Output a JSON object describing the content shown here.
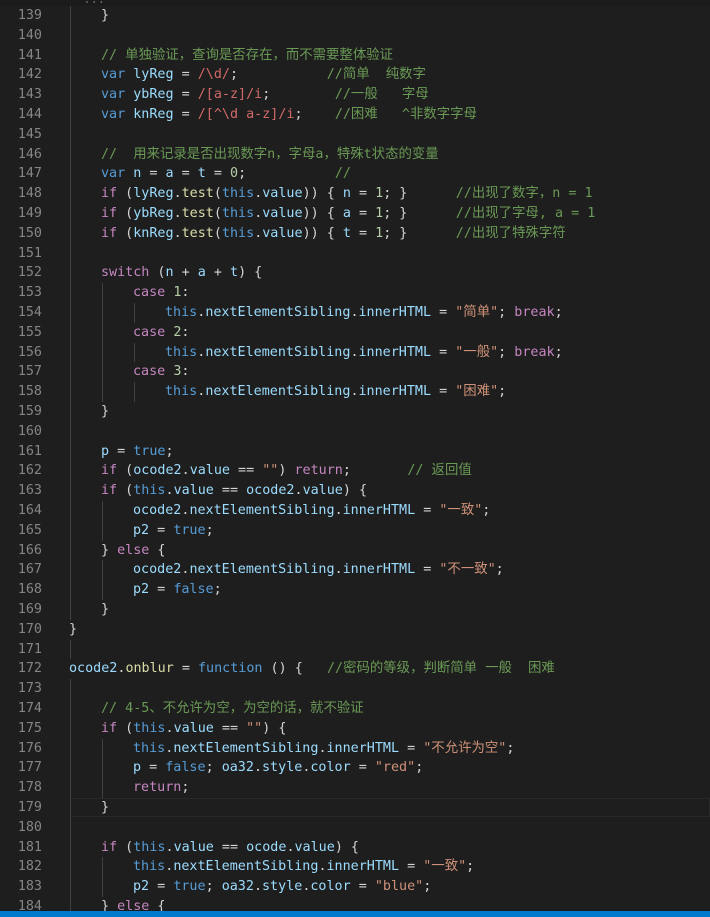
{
  "top_strip_text": "      ...",
  "lines": [
    {
      "n": "139",
      "indent": 2,
      "tokens": [
        [
          "pn",
          "}"
        ]
      ]
    },
    {
      "n": "140",
      "indent": 0,
      "tokens": []
    },
    {
      "n": "141",
      "indent": 2,
      "tokens": [
        [
          "cmt",
          "// 单独验证，查询是否存在，而不需要整体验证"
        ]
      ]
    },
    {
      "n": "142",
      "indent": 2,
      "tokens": [
        [
          "kw",
          "var"
        ],
        [
          "pn",
          " "
        ],
        [
          "var",
          "lyReg"
        ],
        [
          "pn",
          " = "
        ],
        [
          "re",
          "/\\d/"
        ],
        [
          "pn",
          ";           "
        ],
        [
          "cmt",
          "//简单  纯数字"
        ]
      ]
    },
    {
      "n": "143",
      "indent": 2,
      "tokens": [
        [
          "kw",
          "var"
        ],
        [
          "pn",
          " "
        ],
        [
          "var",
          "ybReg"
        ],
        [
          "pn",
          " = "
        ],
        [
          "re",
          "/[a-z]/i"
        ],
        [
          "pn",
          ";        "
        ],
        [
          "cmt",
          "//一般   字母"
        ]
      ]
    },
    {
      "n": "144",
      "indent": 2,
      "tokens": [
        [
          "kw",
          "var"
        ],
        [
          "pn",
          " "
        ],
        [
          "var",
          "knReg"
        ],
        [
          "pn",
          " = "
        ],
        [
          "re",
          "/[^\\d a-z]/i"
        ],
        [
          "pn",
          ";    "
        ],
        [
          "cmt",
          "//困难   ^非数字字母"
        ]
      ]
    },
    {
      "n": "145",
      "indent": 0,
      "tokens": []
    },
    {
      "n": "146",
      "indent": 2,
      "tokens": [
        [
          "cmt",
          "//  用来记录是否出现数字n，字母a，特殊t状态的变量"
        ]
      ]
    },
    {
      "n": "147",
      "indent": 2,
      "tokens": [
        [
          "kw",
          "var"
        ],
        [
          "pn",
          " "
        ],
        [
          "var",
          "n"
        ],
        [
          "pn",
          " = "
        ],
        [
          "var",
          "a"
        ],
        [
          "pn",
          " = "
        ],
        [
          "var",
          "t"
        ],
        [
          "pn",
          " = "
        ],
        [
          "num",
          "0"
        ],
        [
          "pn",
          ";           "
        ],
        [
          "cmt",
          "//"
        ]
      ]
    },
    {
      "n": "148",
      "indent": 2,
      "tokens": [
        [
          "ctl",
          "if"
        ],
        [
          "pn",
          " ("
        ],
        [
          "var",
          "lyReg"
        ],
        [
          "pn",
          "."
        ],
        [
          "fn",
          "test"
        ],
        [
          "pn",
          "("
        ],
        [
          "kw",
          "this"
        ],
        [
          "pn",
          "."
        ],
        [
          "var",
          "value"
        ],
        [
          "pn",
          ")) { "
        ],
        [
          "var",
          "n"
        ],
        [
          "pn",
          " = "
        ],
        [
          "num",
          "1"
        ],
        [
          "pn",
          "; }      "
        ],
        [
          "cmt",
          "//出现了数字，n = 1"
        ]
      ]
    },
    {
      "n": "149",
      "indent": 2,
      "tokens": [
        [
          "ctl",
          "if"
        ],
        [
          "pn",
          " ("
        ],
        [
          "var",
          "ybReg"
        ],
        [
          "pn",
          "."
        ],
        [
          "fn",
          "test"
        ],
        [
          "pn",
          "("
        ],
        [
          "kw",
          "this"
        ],
        [
          "pn",
          "."
        ],
        [
          "var",
          "value"
        ],
        [
          "pn",
          ")) { "
        ],
        [
          "var",
          "a"
        ],
        [
          "pn",
          " = "
        ],
        [
          "num",
          "1"
        ],
        [
          "pn",
          "; }      "
        ],
        [
          "cmt",
          "//出现了字母, a = 1"
        ]
      ]
    },
    {
      "n": "150",
      "indent": 2,
      "tokens": [
        [
          "ctl",
          "if"
        ],
        [
          "pn",
          " ("
        ],
        [
          "var",
          "knReg"
        ],
        [
          "pn",
          "."
        ],
        [
          "fn",
          "test"
        ],
        [
          "pn",
          "("
        ],
        [
          "kw",
          "this"
        ],
        [
          "pn",
          "."
        ],
        [
          "var",
          "value"
        ],
        [
          "pn",
          ")) { "
        ],
        [
          "var",
          "t"
        ],
        [
          "pn",
          " = "
        ],
        [
          "num",
          "1"
        ],
        [
          "pn",
          "; }      "
        ],
        [
          "cmt",
          "//出现了特殊字符"
        ]
      ]
    },
    {
      "n": "151",
      "indent": 0,
      "tokens": []
    },
    {
      "n": "152",
      "indent": 2,
      "tokens": [
        [
          "ctl",
          "switch"
        ],
        [
          "pn",
          " ("
        ],
        [
          "var",
          "n"
        ],
        [
          "pn",
          " + "
        ],
        [
          "var",
          "a"
        ],
        [
          "pn",
          " + "
        ],
        [
          "var",
          "t"
        ],
        [
          "pn",
          ") {"
        ]
      ]
    },
    {
      "n": "153",
      "indent": 3,
      "tokens": [
        [
          "ctl",
          "case"
        ],
        [
          "pn",
          " "
        ],
        [
          "num",
          "1"
        ],
        [
          "pn",
          ":"
        ]
      ]
    },
    {
      "n": "154",
      "indent": 4,
      "tokens": [
        [
          "kw",
          "this"
        ],
        [
          "pn",
          "."
        ],
        [
          "var",
          "nextElementSibling"
        ],
        [
          "pn",
          "."
        ],
        [
          "var",
          "innerHTML"
        ],
        [
          "pn",
          " = "
        ],
        [
          "str",
          "\"简单\""
        ],
        [
          "pn",
          "; "
        ],
        [
          "ctl",
          "break"
        ],
        [
          "pn",
          ";"
        ]
      ]
    },
    {
      "n": "155",
      "indent": 3,
      "tokens": [
        [
          "ctl",
          "case"
        ],
        [
          "pn",
          " "
        ],
        [
          "num",
          "2"
        ],
        [
          "pn",
          ":"
        ]
      ]
    },
    {
      "n": "156",
      "indent": 4,
      "tokens": [
        [
          "kw",
          "this"
        ],
        [
          "pn",
          "."
        ],
        [
          "var",
          "nextElementSibling"
        ],
        [
          "pn",
          "."
        ],
        [
          "var",
          "innerHTML"
        ],
        [
          "pn",
          " = "
        ],
        [
          "str",
          "\"一般\""
        ],
        [
          "pn",
          "; "
        ],
        [
          "ctl",
          "break"
        ],
        [
          "pn",
          ";"
        ]
      ]
    },
    {
      "n": "157",
      "indent": 3,
      "tokens": [
        [
          "ctl",
          "case"
        ],
        [
          "pn",
          " "
        ],
        [
          "num",
          "3"
        ],
        [
          "pn",
          ":"
        ]
      ]
    },
    {
      "n": "158",
      "indent": 4,
      "tokens": [
        [
          "kw",
          "this"
        ],
        [
          "pn",
          "."
        ],
        [
          "var",
          "nextElementSibling"
        ],
        [
          "pn",
          "."
        ],
        [
          "var",
          "innerHTML"
        ],
        [
          "pn",
          " = "
        ],
        [
          "str",
          "\"困难\""
        ],
        [
          "pn",
          ";"
        ]
      ]
    },
    {
      "n": "159",
      "indent": 2,
      "tokens": [
        [
          "pn",
          "}"
        ]
      ]
    },
    {
      "n": "160",
      "indent": 0,
      "tokens": []
    },
    {
      "n": "161",
      "indent": 2,
      "tokens": [
        [
          "var",
          "p"
        ],
        [
          "pn",
          " = "
        ],
        [
          "kw",
          "true"
        ],
        [
          "pn",
          ";"
        ]
      ]
    },
    {
      "n": "162",
      "indent": 2,
      "tokens": [
        [
          "ctl",
          "if"
        ],
        [
          "pn",
          " ("
        ],
        [
          "var",
          "ocode2"
        ],
        [
          "pn",
          "."
        ],
        [
          "var",
          "value"
        ],
        [
          "pn",
          " == "
        ],
        [
          "str",
          "\"\""
        ],
        [
          "pn",
          ") "
        ],
        [
          "ctl",
          "return"
        ],
        [
          "pn",
          ";       "
        ],
        [
          "cmt",
          "// 返回值"
        ]
      ]
    },
    {
      "n": "163",
      "indent": 2,
      "tokens": [
        [
          "ctl",
          "if"
        ],
        [
          "pn",
          " ("
        ],
        [
          "kw",
          "this"
        ],
        [
          "pn",
          "."
        ],
        [
          "var",
          "value"
        ],
        [
          "pn",
          " == "
        ],
        [
          "var",
          "ocode2"
        ],
        [
          "pn",
          "."
        ],
        [
          "var",
          "value"
        ],
        [
          "pn",
          ") {"
        ]
      ]
    },
    {
      "n": "164",
      "indent": 3,
      "tokens": [
        [
          "var",
          "ocode2"
        ],
        [
          "pn",
          "."
        ],
        [
          "var",
          "nextElementSibling"
        ],
        [
          "pn",
          "."
        ],
        [
          "var",
          "innerHTML"
        ],
        [
          "pn",
          " = "
        ],
        [
          "str",
          "\"一致\""
        ],
        [
          "pn",
          ";"
        ]
      ]
    },
    {
      "n": "165",
      "indent": 3,
      "tokens": [
        [
          "var",
          "p2"
        ],
        [
          "pn",
          " = "
        ],
        [
          "kw",
          "true"
        ],
        [
          "pn",
          ";"
        ]
      ]
    },
    {
      "n": "166",
      "indent": 2,
      "tokens": [
        [
          "pn",
          "} "
        ],
        [
          "ctl",
          "else"
        ],
        [
          "pn",
          " {"
        ]
      ]
    },
    {
      "n": "167",
      "indent": 3,
      "tokens": [
        [
          "var",
          "ocode2"
        ],
        [
          "pn",
          "."
        ],
        [
          "var",
          "nextElementSibling"
        ],
        [
          "pn",
          "."
        ],
        [
          "var",
          "innerHTML"
        ],
        [
          "pn",
          " = "
        ],
        [
          "str",
          "\"不一致\""
        ],
        [
          "pn",
          ";"
        ]
      ]
    },
    {
      "n": "168",
      "indent": 3,
      "tokens": [
        [
          "var",
          "p2"
        ],
        [
          "pn",
          " = "
        ],
        [
          "kw",
          "false"
        ],
        [
          "pn",
          ";"
        ]
      ]
    },
    {
      "n": "169",
      "indent": 2,
      "tokens": [
        [
          "pn",
          "}"
        ]
      ]
    },
    {
      "n": "170",
      "indent": 1,
      "tokens": [
        [
          "pn",
          "}"
        ]
      ]
    },
    {
      "n": "171",
      "indent": 0,
      "tokens": []
    },
    {
      "n": "172",
      "indent": 1,
      "tokens": [
        [
          "var",
          "ocode2"
        ],
        [
          "pn",
          "."
        ],
        [
          "fn",
          "onblur"
        ],
        [
          "pn",
          " = "
        ],
        [
          "kw",
          "function"
        ],
        [
          "pn",
          " () {   "
        ],
        [
          "cmt",
          "//密码的等级，判断简单 一般  困难"
        ]
      ]
    },
    {
      "n": "173",
      "indent": 0,
      "tokens": []
    },
    {
      "n": "174",
      "indent": 2,
      "tokens": [
        [
          "cmt",
          "// 4-5、不允许为空，为空的话，就不验证"
        ]
      ]
    },
    {
      "n": "175",
      "indent": 2,
      "tokens": [
        [
          "ctl",
          "if"
        ],
        [
          "pn",
          " ("
        ],
        [
          "kw",
          "this"
        ],
        [
          "pn",
          "."
        ],
        [
          "var",
          "value"
        ],
        [
          "pn",
          " == "
        ],
        [
          "str",
          "\"\""
        ],
        [
          "pn",
          ") {"
        ]
      ]
    },
    {
      "n": "176",
      "indent": 3,
      "tokens": [
        [
          "kw",
          "this"
        ],
        [
          "pn",
          "."
        ],
        [
          "var",
          "nextElementSibling"
        ],
        [
          "pn",
          "."
        ],
        [
          "var",
          "innerHTML"
        ],
        [
          "pn",
          " = "
        ],
        [
          "str",
          "\"不允许为空\""
        ],
        [
          "pn",
          ";"
        ]
      ]
    },
    {
      "n": "177",
      "indent": 3,
      "tokens": [
        [
          "var",
          "p"
        ],
        [
          "pn",
          " = "
        ],
        [
          "kw",
          "false"
        ],
        [
          "pn",
          "; "
        ],
        [
          "var",
          "oa32"
        ],
        [
          "pn",
          "."
        ],
        [
          "var",
          "style"
        ],
        [
          "pn",
          "."
        ],
        [
          "var",
          "color"
        ],
        [
          "pn",
          " = "
        ],
        [
          "str",
          "\"red\""
        ],
        [
          "pn",
          ";"
        ]
      ]
    },
    {
      "n": "178",
      "indent": 3,
      "tokens": [
        [
          "ctl",
          "return"
        ],
        [
          "pn",
          ";"
        ]
      ]
    },
    {
      "n": "179",
      "indent": 2,
      "tokens": [
        [
          "pn",
          "}"
        ]
      ]
    },
    {
      "n": "180",
      "indent": 0,
      "tokens": []
    },
    {
      "n": "181",
      "indent": 2,
      "tokens": [
        [
          "ctl",
          "if"
        ],
        [
          "pn",
          " ("
        ],
        [
          "kw",
          "this"
        ],
        [
          "pn",
          "."
        ],
        [
          "var",
          "value"
        ],
        [
          "pn",
          " == "
        ],
        [
          "var",
          "ocode"
        ],
        [
          "pn",
          "."
        ],
        [
          "var",
          "value"
        ],
        [
          "pn",
          ") {"
        ]
      ]
    },
    {
      "n": "182",
      "indent": 3,
      "tokens": [
        [
          "kw",
          "this"
        ],
        [
          "pn",
          "."
        ],
        [
          "var",
          "nextElementSibling"
        ],
        [
          "pn",
          "."
        ],
        [
          "var",
          "innerHTML"
        ],
        [
          "pn",
          " = "
        ],
        [
          "str",
          "\"一致\""
        ],
        [
          "pn",
          ";"
        ]
      ]
    },
    {
      "n": "183",
      "indent": 3,
      "tokens": [
        [
          "var",
          "p2"
        ],
        [
          "pn",
          " = "
        ],
        [
          "kw",
          "true"
        ],
        [
          "pn",
          "; "
        ],
        [
          "var",
          "oa32"
        ],
        [
          "pn",
          "."
        ],
        [
          "var",
          "style"
        ],
        [
          "pn",
          "."
        ],
        [
          "var",
          "color"
        ],
        [
          "pn",
          " = "
        ],
        [
          "str",
          "\"blue\""
        ],
        [
          "pn",
          ";"
        ]
      ]
    },
    {
      "n": "184",
      "indent": 2,
      "tokens": [
        [
          "pn",
          "} "
        ],
        [
          "ctl",
          "else"
        ],
        [
          "pn",
          " {"
        ]
      ]
    }
  ],
  "current_line": "179",
  "colors": {
    "background": "#1e1e1e",
    "keyword": "#569cd6",
    "control": "#c586c0",
    "variable": "#9cdcfe",
    "function": "#dcdcaa",
    "string": "#ce9178",
    "regex": "#d16969",
    "number": "#b5cea8",
    "comment": "#6a9955",
    "line_number": "#858585",
    "status_bar": "#007acc"
  }
}
